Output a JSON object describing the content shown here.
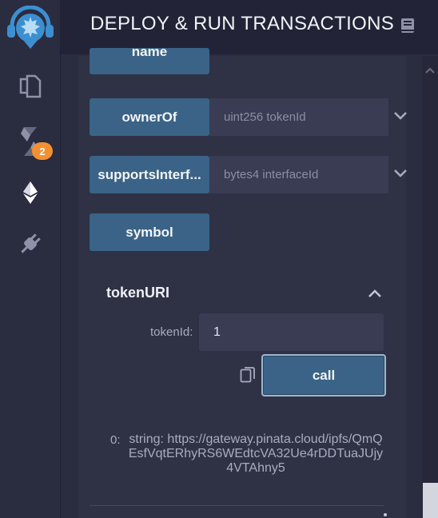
{
  "header": {
    "title": "DEPLOY & RUN TRANSACTIONS"
  },
  "rail": {
    "compiler_badge": "2"
  },
  "functions": [
    {
      "label": "name",
      "placeholder": ""
    },
    {
      "label": "ownerOf",
      "placeholder": "uint256 tokenId"
    },
    {
      "label": "supportsInterf...",
      "placeholder": "bytes4 interfaceId"
    },
    {
      "label": "symbol",
      "placeholder": ""
    }
  ],
  "expanded": {
    "title": "tokenURI",
    "param_label": "tokenId:",
    "param_value": "1",
    "call_label": "call",
    "result_index": "0:",
    "result_text": "string: https://gateway.pinata.cloud/ipfs/QmQEsfVqtERhyRS6WEdtcVA32Ue4rDDTuaJUjy4VTAhny5"
  },
  "colors": {
    "accent": "#3a6387",
    "badge": "#f59030",
    "background": "#2a2c3f"
  }
}
